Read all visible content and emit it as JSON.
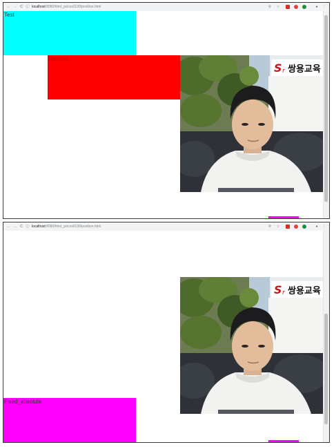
{
  "browser": {
    "nav_back": "←",
    "nav_forward": "→",
    "nav_reload": "C",
    "info_icon": "ⓘ",
    "url_host": "localhost",
    "url_path": ":8080/html_ys/css0130/position.html",
    "search_icon": "⚲",
    "star_icon": "☆",
    "profile_icon": "●",
    "menu_icon": "⋮"
  },
  "boxes": {
    "static_label": "Test",
    "relative_label": "Relative",
    "fixed_label": "Fixed_absolute"
  },
  "photo": {
    "logo_text": "쌍용교육"
  },
  "colors": {
    "static_box": "#00ffff",
    "relative_box": "#ff0000",
    "fixed_box": "#ff00ff"
  }
}
